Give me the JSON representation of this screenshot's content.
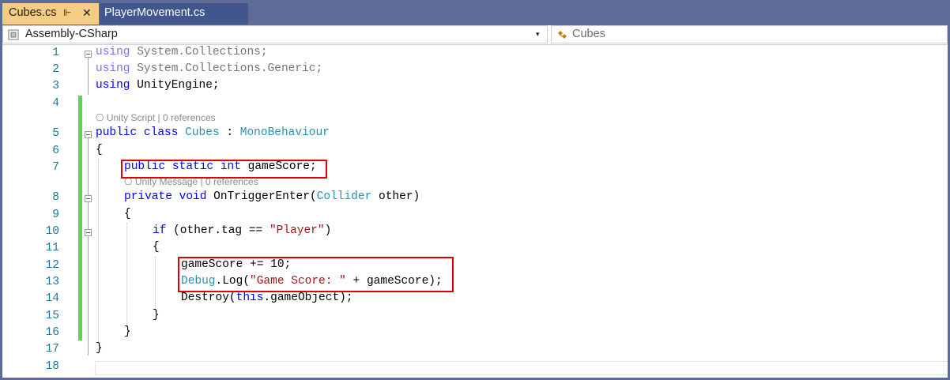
{
  "tabs": [
    {
      "label": "Cubes.cs",
      "pin_glyph": "⊩",
      "close_glyph": "✕"
    },
    {
      "label": "PlayerMovement.cs"
    }
  ],
  "navbar": {
    "project": "Assembly-CSharp",
    "dropdown_glyph": "▾",
    "member": "Cubes"
  },
  "code": {
    "line_numbers": [
      "1",
      "2",
      "3",
      "4",
      "5",
      "6",
      "7",
      "8",
      "9",
      "10",
      "11",
      "12",
      "13",
      "14",
      "15",
      "16",
      "17",
      "18"
    ],
    "lines": {
      "l1": [
        "using",
        " System.Collections;"
      ],
      "l2": [
        "using",
        " System.Collections.Generic;"
      ],
      "l3": [
        "using",
        " UnityEngine;"
      ],
      "l5": [
        "public",
        " ",
        "class",
        " ",
        "Cubes",
        " : ",
        "MonoBehaviour"
      ],
      "l6": "{",
      "l7": [
        "public",
        " ",
        "static",
        " ",
        "int",
        " gameScore;"
      ],
      "l8": [
        "private",
        " ",
        "void",
        " OnTriggerEnter(",
        "Collider",
        " other)"
      ],
      "l9": "{",
      "l10": [
        "if",
        " (other.tag == ",
        "\"Player\"",
        ")"
      ],
      "l11": "{",
      "l12": "gameScore += 10;",
      "l13": [
        "Debug",
        ".Log(",
        "\"Game Score: \"",
        " + gameScore);"
      ],
      "l14": [
        "Destroy(",
        "this",
        ".gameObject);"
      ],
      "l15": "}",
      "l16": "}",
      "l17": "}"
    },
    "codelens_class": "Unity Script | 0 references",
    "codelens_method": "Unity Message | 0 references"
  },
  "colors": {
    "keyword": "#0000ff",
    "type": "#2b91af",
    "string": "#a31515",
    "line_number": "#237893",
    "highlight_box": "#e00000",
    "change_bar": "#5bd35b",
    "active_tab": "#f5cc84",
    "inactive_tab": "#40568d"
  }
}
